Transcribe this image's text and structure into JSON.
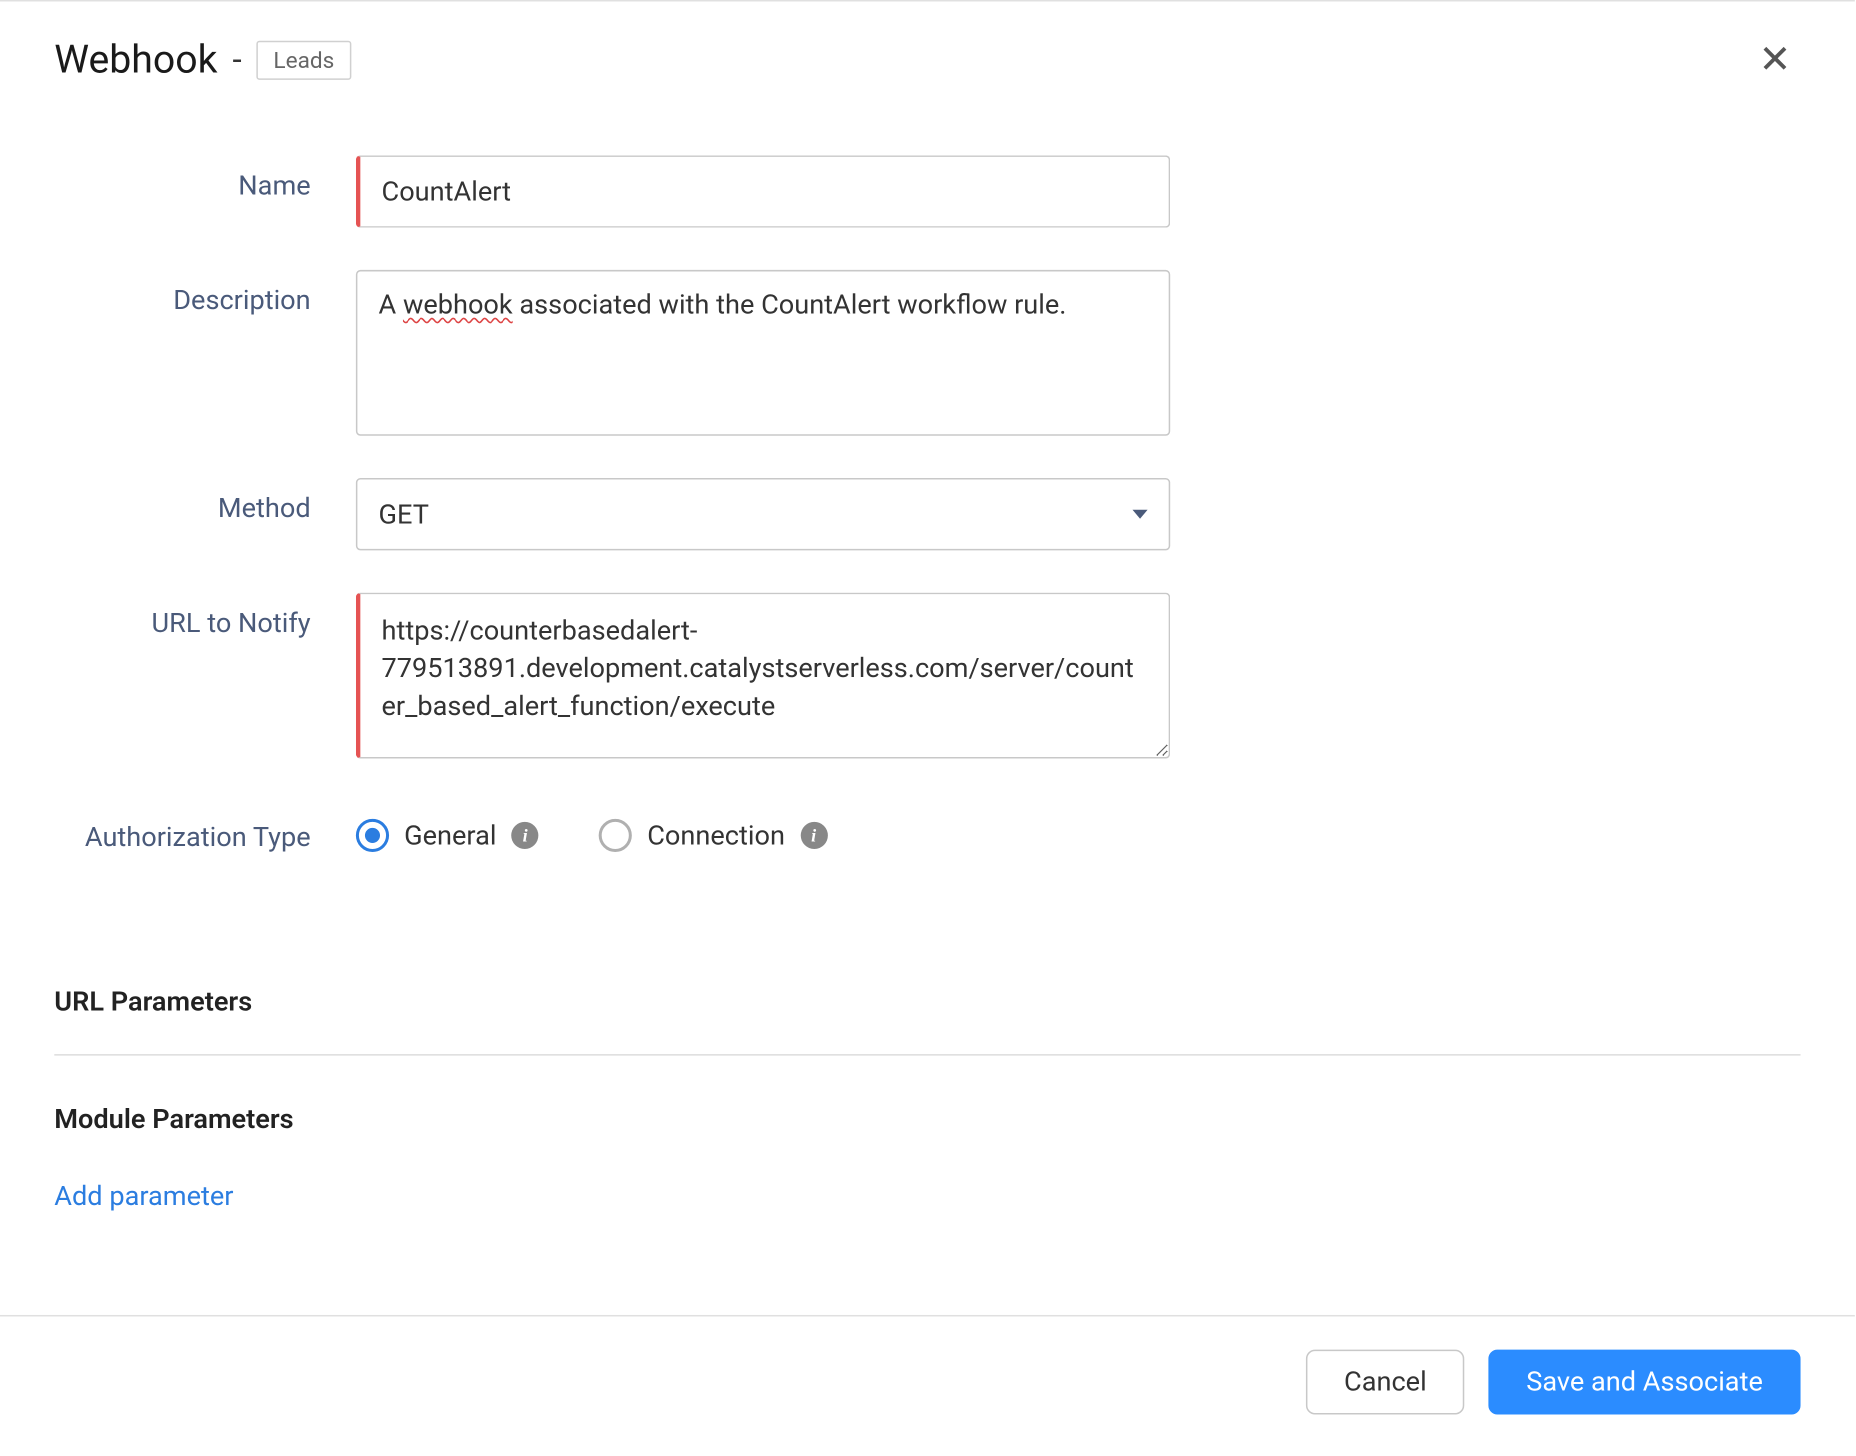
{
  "header": {
    "title": "Webhook",
    "separator": "-",
    "module_tag": "Leads"
  },
  "form": {
    "labels": {
      "name": "Name",
      "description": "Description",
      "method": "Method",
      "url": "URL to Notify",
      "auth_type": "Authorization Type"
    },
    "values": {
      "name": "CountAlert",
      "description_prefix": "A ",
      "description_spellerr": "webhook",
      "description_suffix": " associated with the CountAlert workflow rule.",
      "method": "GET",
      "url": "https://counterbasedalert-779513891.development.catalystserverless.com/server/counter_based_alert_function/execute"
    },
    "auth_options": {
      "general": "General",
      "connection": "Connection"
    }
  },
  "sections": {
    "url_params_title": "URL Parameters",
    "module_params_title": "Module Parameters",
    "add_parameter": "Add parameter"
  },
  "footer": {
    "cancel": "Cancel",
    "save": "Save and Associate"
  }
}
